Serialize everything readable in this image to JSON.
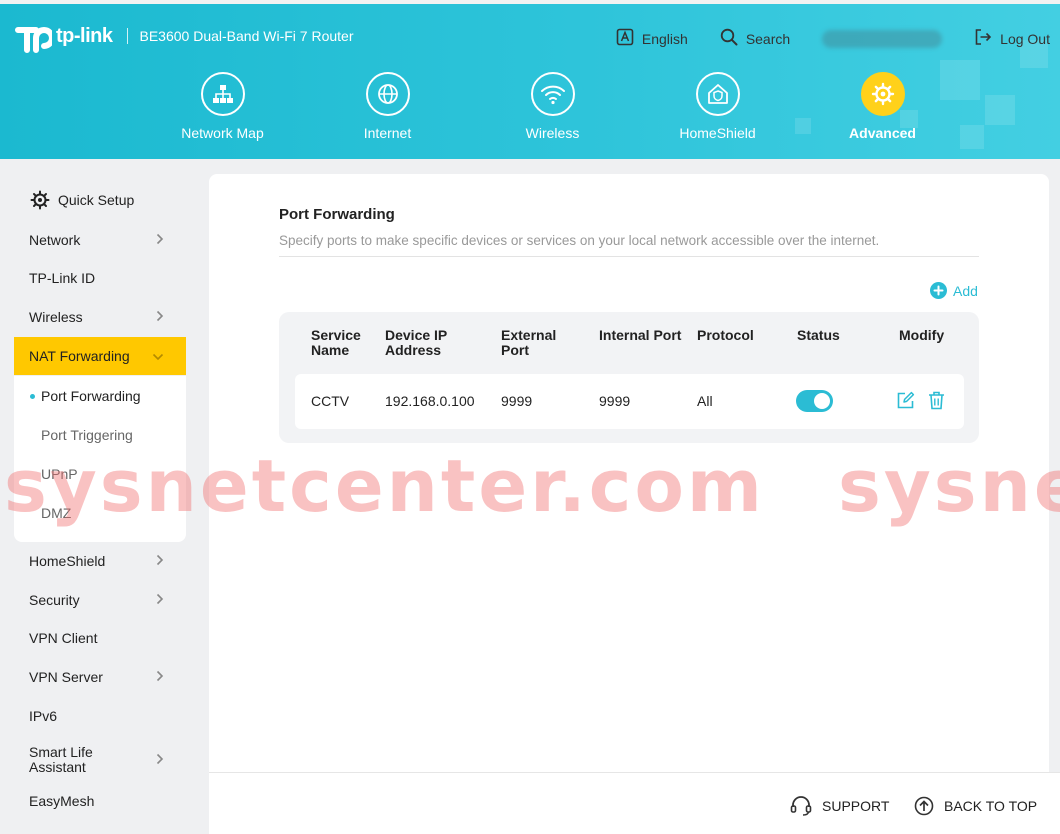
{
  "header": {
    "brand": "tp-link",
    "model": "BE3600 Dual-Band Wi-Fi 7 Router",
    "language_label": "English",
    "search_label": "Search",
    "logout_label": "Log Out",
    "accent_color": "#2ec4da",
    "active_color": "#ffd11a"
  },
  "nav": [
    {
      "label": "Network Map",
      "icon": "network-map-icon"
    },
    {
      "label": "Internet",
      "icon": "globe-icon"
    },
    {
      "label": "Wireless",
      "icon": "wifi-icon"
    },
    {
      "label": "HomeShield",
      "icon": "homeshield-icon"
    },
    {
      "label": "Advanced",
      "icon": "gear-icon",
      "active": true
    }
  ],
  "sidebar": {
    "quick_setup": "Quick Setup",
    "items": [
      {
        "label": "Network"
      },
      {
        "label": "TP-Link ID"
      },
      {
        "label": "Wireless"
      },
      {
        "label": "NAT Forwarding",
        "active": true
      },
      {
        "label": "HomeShield"
      },
      {
        "label": "Security"
      },
      {
        "label": "VPN Client"
      },
      {
        "label": "VPN Server"
      },
      {
        "label": "IPv6"
      },
      {
        "label": "Smart Life Assistant"
      },
      {
        "label": "EasyMesh"
      }
    ],
    "sub_items": [
      {
        "label": "Port Forwarding",
        "active": true
      },
      {
        "label": "Port Triggering"
      },
      {
        "label": "UPnP"
      },
      {
        "label": "DMZ"
      }
    ]
  },
  "main": {
    "title": "Port Forwarding",
    "description": "Specify ports to make specific devices or services on your local network accessible over the internet.",
    "add_label": "Add",
    "table": {
      "headers": [
        {
          "line1": "Service",
          "line2": "Name"
        },
        {
          "line1": "Device IP",
          "line2": "Address"
        },
        {
          "line1": "External",
          "line2": "Port"
        },
        {
          "line1": "Internal Port",
          "line2": ""
        },
        {
          "line1": "Protocol",
          "line2": ""
        },
        {
          "line1": "Status",
          "line2": ""
        },
        {
          "line1": "Modify",
          "line2": ""
        }
      ],
      "rows": [
        {
          "service_name": "CCTV",
          "device_ip": "192.168.0.100",
          "external_port": "9999",
          "internal_port": "9999",
          "protocol": "All",
          "status": "on"
        }
      ]
    }
  },
  "watermark": "sysnetcenter.com",
  "watermark_right": "sysne",
  "footer": {
    "support_label": "SUPPORT",
    "back_to_top_label": "BACK TO TOP"
  }
}
